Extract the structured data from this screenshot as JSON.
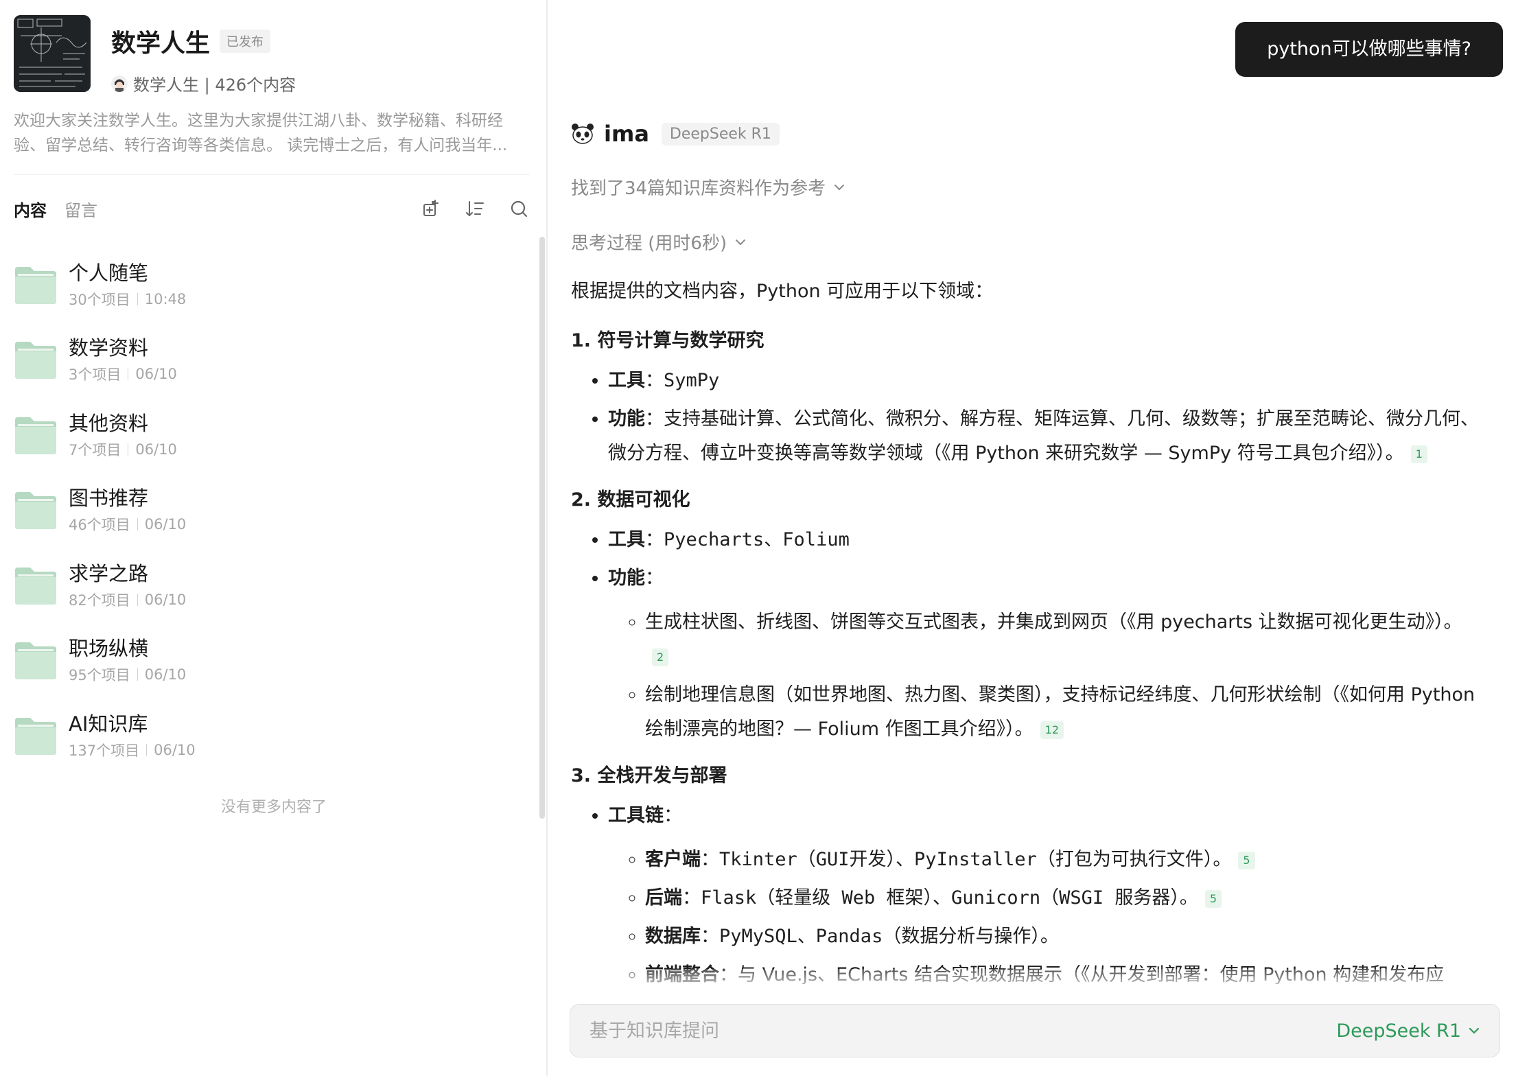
{
  "knowledge_base": {
    "title": "数学人生",
    "status_badge": "已发布",
    "owner_line": "数学人生 | 426个内容",
    "description": "欢迎大家关注数学人生。这里为大家提供江湖八卦、数学秘籍、科研经验、留学总结、转行咨询等各类信息。 读完博士之后，有人问我当年..."
  },
  "tabs": [
    {
      "label": "内容",
      "active": true
    },
    {
      "label": "留言",
      "active": false
    }
  ],
  "toolbar_icons": [
    "add-folder-icon",
    "sort-icon",
    "search-icon"
  ],
  "folders": [
    {
      "name": "个人随笔",
      "count": "30个项目",
      "date": "10:48"
    },
    {
      "name": "数学资料",
      "count": "3个项目",
      "date": "06/10"
    },
    {
      "name": "其他资料",
      "count": "7个项目",
      "date": "06/10"
    },
    {
      "name": "图书推荐",
      "count": "46个项目",
      "date": "06/10"
    },
    {
      "name": "求学之路",
      "count": "82个项目",
      "date": "06/10"
    },
    {
      "name": "职场纵横",
      "count": "95个项目",
      "date": "06/10"
    },
    {
      "name": "AI知识库",
      "count": "137个项目",
      "date": "06/10"
    }
  ],
  "no_more": "没有更多内容了",
  "chat": {
    "user_message": "python可以做哪些事情?",
    "assistant_name": "ima",
    "model_tag": "DeepSeek R1",
    "references_toggle": "找到了34篇知识库资料作为参考",
    "thinking_toggle": "思考过程 (用时6秒)",
    "intro": "根据提供的文档内容，Python 可应用于以下领域：",
    "s1": {
      "heading": "1. 符号计算与数学研究",
      "tool_label": "工具",
      "tool_value": "SymPy",
      "func_label": "功能",
      "func_value": "支持基础计算、公式简化、微积分、解方程、矩阵运算、几何、级数等；扩展至范畴论、微分几何、微分方程、傅立叶变换等高等数学领域（《用 Python 来研究数学 — SymPy 符号工具包介绍》）。",
      "cite": "1"
    },
    "s2": {
      "heading": "2. 数据可视化",
      "tool_label": "工具",
      "tool_value": "Pyecharts、Folium",
      "func_label": "功能",
      "items": [
        {
          "text": "生成柱状图、折线图、饼图等交互式图表，并集成到网页（《用 pyecharts 让数据可视化更生动》）。",
          "cite": "2"
        },
        {
          "text": "绘制地理信息图（如世界地图、热力图、聚类图），支持标记经纬度、几何形状绘制（《如何用 Python 绘制漂亮的地图？— Folium 作图工具介绍》）。",
          "cite": "12"
        }
      ]
    },
    "s3": {
      "heading": "3. 全栈开发与部署",
      "toolchain_label": "工具链",
      "client_label": "客户端",
      "client_value": "Tkinter（GUI开发）、PyInstaller（打包为可执行文件）。",
      "client_cite": "5",
      "backend_label": "后端",
      "backend_value": "Flask（轻量级 Web 框架）、Gunicorn（WSGI 服务器）。",
      "backend_cite": "5",
      "db_label": "数据库",
      "db_value": "PyMySQL、Pandas（数据分析与操作）。",
      "frontend_label": "前端整合",
      "frontend_value": "与 Vue.js、ECharts 结合实现数据展示（《从开发到部署：使用 Python 构建和发布应用》）。"
    }
  },
  "input": {
    "placeholder": "基于知识库提问",
    "model": "DeepSeek R1"
  },
  "colors": {
    "accent_green": "#2e9a59",
    "bubble_bg": "#1c1c1c",
    "folder_green": "#c6e3cf"
  }
}
